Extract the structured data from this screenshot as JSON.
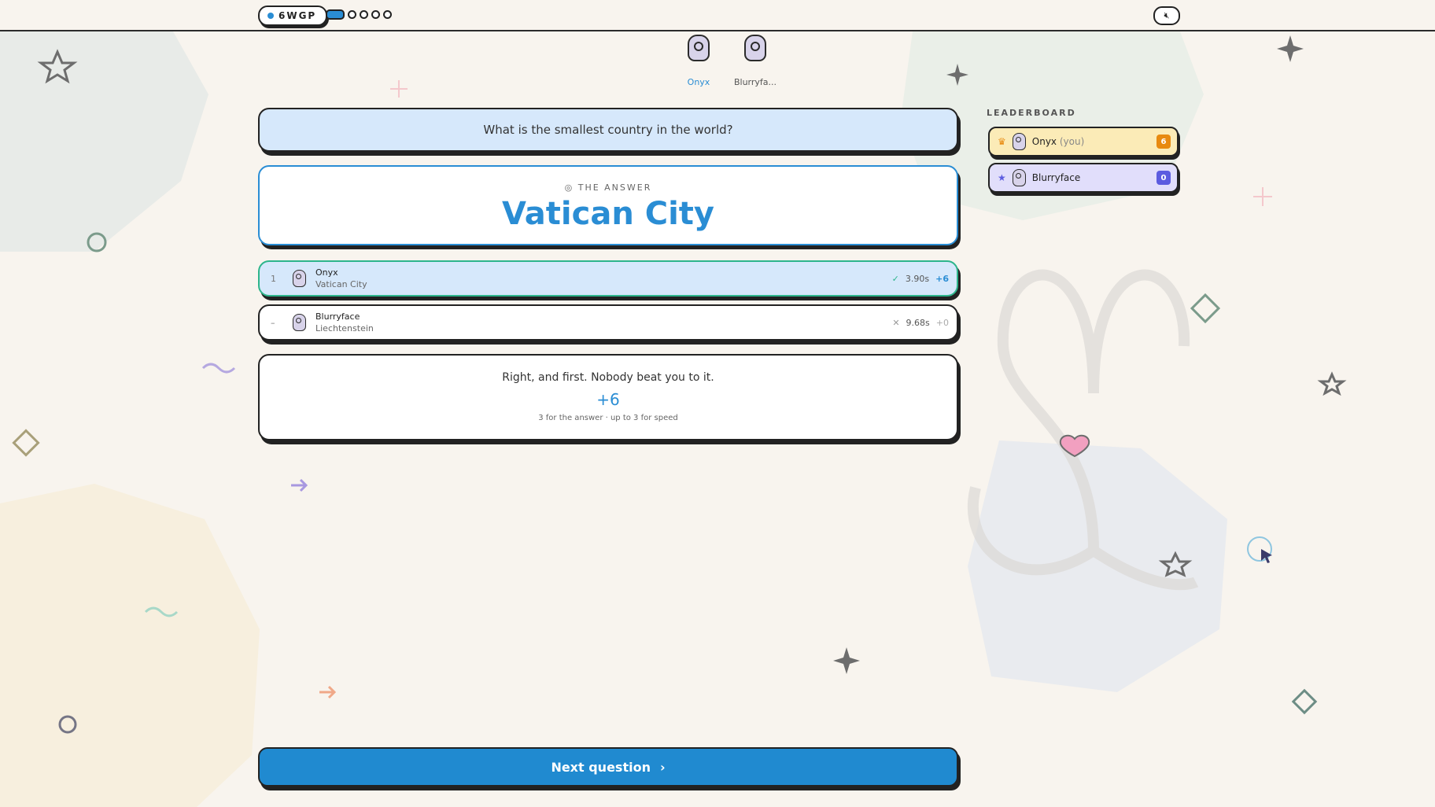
{
  "header": {
    "room_code": "6WGP",
    "question_progress": {
      "current": 1,
      "total": 5
    },
    "mute_icon": "speaker-mute-icon"
  },
  "players_top": [
    {
      "name": "Onyx",
      "is_me": true
    },
    {
      "name": "Blurryfa..."
    }
  ],
  "question": {
    "text": "What is the smallest country in the world?"
  },
  "answer": {
    "label": "THE ANSWER",
    "value": "Vatican City",
    "icon": "target-icon"
  },
  "results": [
    {
      "rank": "1",
      "name": "Onyx",
      "answer": "Vatican City",
      "correct": true,
      "time": "3.90s",
      "points": "+6"
    },
    {
      "rank": "–",
      "name": "Blurryface",
      "answer": "Liechtenstein",
      "correct": false,
      "time": "9.68s",
      "points": "+0"
    }
  ],
  "feedback": {
    "message": "Right, and first. Nobody beat you to it.",
    "points": "+6",
    "breakdown": "3 for the answer · up to 3 for speed"
  },
  "leaderboard": {
    "title": "LEADERBOARD",
    "entries": [
      {
        "name": "Onyx",
        "you_tag": "(you)",
        "score": "6",
        "icon": "crown-icon",
        "score_color": "#e88a10"
      },
      {
        "name": "Blurryface",
        "score": "0",
        "icon": "star-icon",
        "score_color": "#5c5ce0"
      }
    ]
  },
  "next_button": {
    "label": "Next question"
  },
  "colors": {
    "accent": "#2a8dd4",
    "correct": "#2db58b",
    "background": "#f8f4ee"
  }
}
